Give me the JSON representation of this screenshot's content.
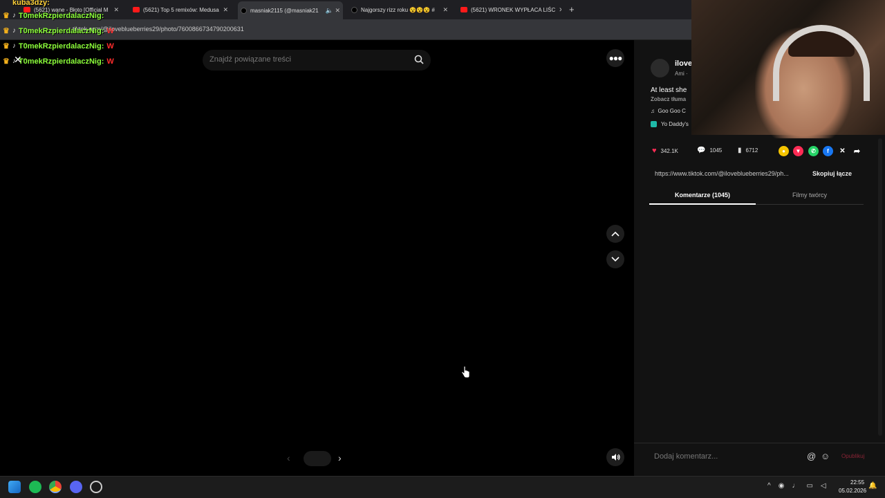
{
  "browser": {
    "tabs": [
      {
        "label": "(5621) wane - Błoto [Official M",
        "type": "yt"
      },
      {
        "label": "(5621) Top 5 remixów: Medusa",
        "type": "yt"
      },
      {
        "label": "masniak2115 (@masniak21",
        "type": "tt"
      },
      {
        "label": "Najgorszy rizz roku 😵😵😵 #",
        "type": "tt"
      },
      {
        "label": "(5621) WRONEK WYPŁACA LIŚC",
        "type": "yt"
      }
    ],
    "new_tab": "+",
    "url": "tiktok.com/@iloveblueberries29/photo/7600866734790200631"
  },
  "chat_overlay": {
    "top_user": "kuba3dzy:",
    "lines": [
      {
        "name": "T0mekRzpierdalaczNig:",
        "msg": ""
      },
      {
        "name": "T0mekRzpierdalaczNig:",
        "msg": "W"
      },
      {
        "name": "T0mekRzpierdalaczNig:",
        "msg": "W"
      },
      {
        "name": "T0mekRzpierdalaczNig:",
        "msg": "W"
      }
    ]
  },
  "viewer": {
    "search_placeholder": "Znajdź powiązane treści",
    "more_icon": "more-horizontal-icon",
    "up_icon": "chevron-up-icon",
    "down_icon": "chevron-down-icon",
    "sound_icon": "volume-icon",
    "prev": "‹",
    "next": "›",
    "close": "✕"
  },
  "post": {
    "author": "ilove",
    "author_sub": "Ami ·",
    "caption": "At least she",
    "translate": "Zobacz tłuma",
    "music": "Goo Goo C",
    "effect": "Yo Daddy's",
    "likes": "342.1K",
    "comments": "1045",
    "saves": "6712",
    "link": "https://www.tiktok.com/@iloveblueberries29/ph...",
    "copy_link": "Skopiuj łącze",
    "tab_comments": "Komentarze (1045)",
    "tab_videos": "Filmy twórcy",
    "comment_placeholder": "Dodaj komentarz...",
    "post_button": "Opublikuj",
    "accent": "#fe2c55"
  },
  "taskbar": {
    "time": "22:55",
    "date": "05.02.2026"
  }
}
